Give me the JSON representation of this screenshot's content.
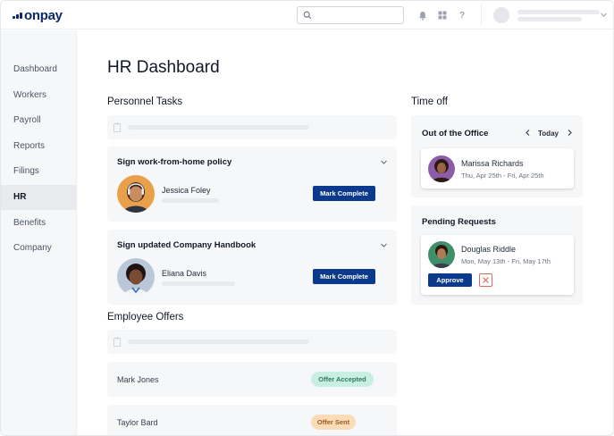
{
  "header": {
    "logo_text": "onpay",
    "search": {
      "value": "",
      "placeholder": ""
    },
    "icons": [
      "bell-icon",
      "grid-icon",
      "help-icon",
      "chevron-down-icon"
    ],
    "help_glyph": "?"
  },
  "sidebar": {
    "items": [
      {
        "label": "Dashboard",
        "active": false
      },
      {
        "label": "Workers",
        "active": false
      },
      {
        "label": "Payroll",
        "active": false
      },
      {
        "label": "Reports",
        "active": false
      },
      {
        "label": "Filings",
        "active": false
      },
      {
        "label": "HR",
        "active": true
      },
      {
        "label": "Benefits",
        "active": false
      },
      {
        "label": "Company",
        "active": false
      }
    ]
  },
  "main": {
    "title": "HR Dashboard",
    "personnel_tasks": {
      "title": "Personnel Tasks",
      "tasks": [
        {
          "title": "Sign work-from-home policy",
          "person": "Jessica Foley",
          "action": "Mark Complete"
        },
        {
          "title": "Sign updated Company Handbook",
          "person": "Eliana Davis",
          "action": "Mark Complete"
        }
      ]
    },
    "employee_offers": {
      "title": "Employee Offers",
      "rows": [
        {
          "name": "Mark Jones",
          "status": "Offer Accepted"
        },
        {
          "name": "Taylor Bard",
          "status": "Offer Sent"
        }
      ]
    }
  },
  "time_off": {
    "title": "Time off",
    "out_of_office": {
      "title": "Out of the Office",
      "nav_label": "Today",
      "entries": [
        {
          "name": "Marissa Richards",
          "dates": "Thu, Apr 25th - Fri, Apr 25th"
        }
      ]
    },
    "pending_requests": {
      "title": "Pending Requests",
      "entries": [
        {
          "name": "Douglas Riddle",
          "dates": "Mon, May 13th - Fri, May 17th",
          "approve_label": "Approve"
        }
      ]
    }
  },
  "colors": {
    "brand_navy": "#0b2a66",
    "primary_button": "#0b3a8c",
    "accepted_badge": "#c9efe3",
    "sent_badge": "#fadcb8",
    "reject_border": "#e26a5a"
  }
}
